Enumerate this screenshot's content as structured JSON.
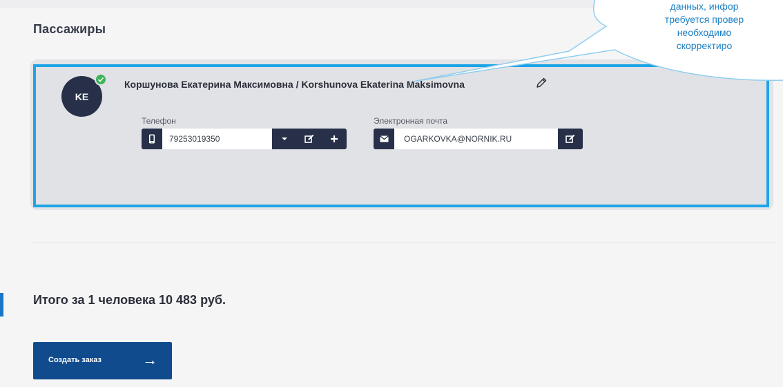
{
  "section": {
    "title": "Пассажиры"
  },
  "passenger": {
    "initials": "KE",
    "name": "Коршунова Екатерина Максимовна / Korshunova Ekaterina Maksimovna",
    "phone": {
      "label": "Телефон",
      "value": "79253019350"
    },
    "email": {
      "label": "Электронная почта",
      "value": "OGARKOVKA@NORNIK.RU"
    }
  },
  "total": {
    "text": "Итого за 1 человека 10 483 руб."
  },
  "create_order": {
    "label": "Создать заказ",
    "arrow": "→"
  },
  "tooltip": {
    "lines": [
      "данных, инфор",
      "требуется провер",
      "необходимо",
      "скорректиро"
    ]
  },
  "icons": {
    "check": "check-icon",
    "pencil": "pencil-icon",
    "phone": "mobile-phone-icon",
    "dropdown": "caret-down-icon",
    "edit": "edit-icon",
    "add": "plus-icon",
    "email": "envelope-icon"
  },
  "colors": {
    "accent_border": "#1ca4e6",
    "dark_navy": "#273048",
    "button_blue": "#104b8d",
    "success_green": "#3db35a",
    "tooltip_text": "#1c7fc4"
  }
}
